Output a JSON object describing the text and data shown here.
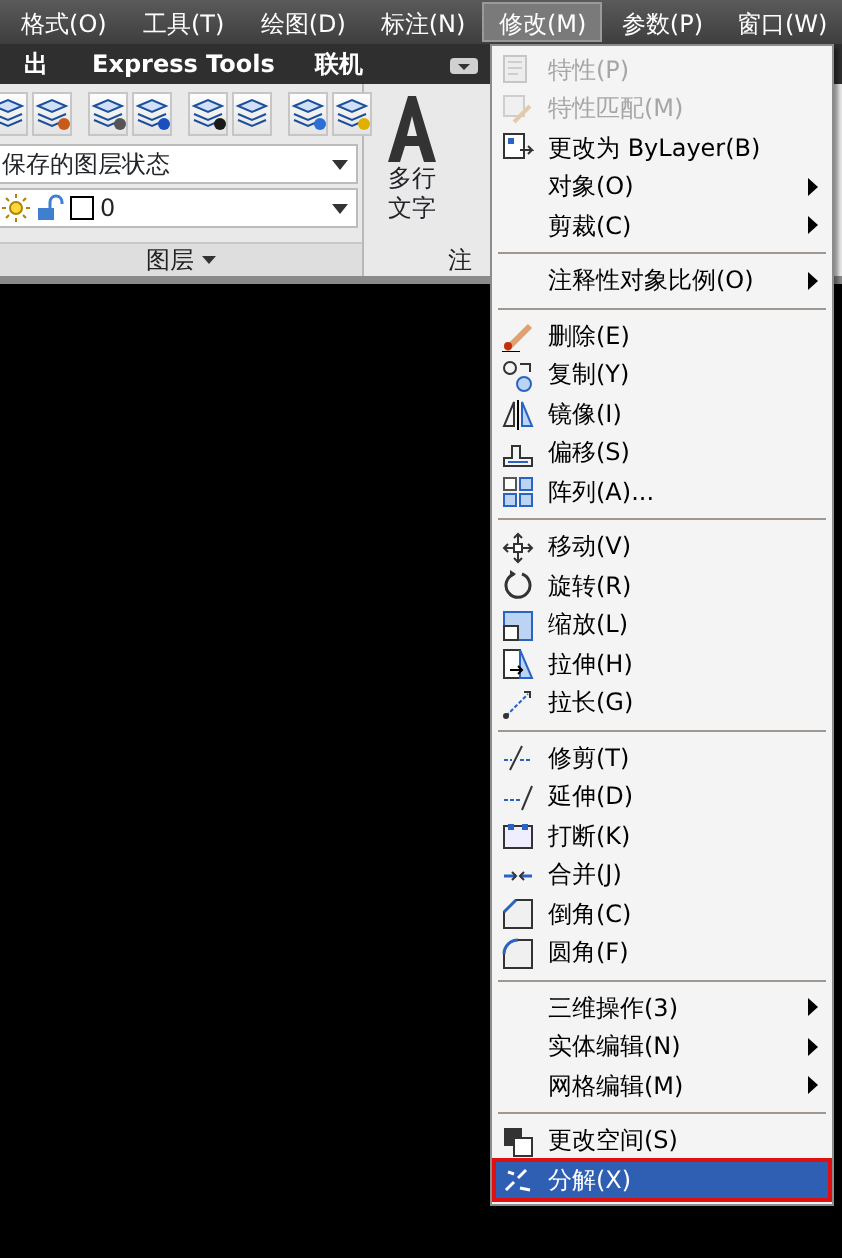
{
  "menu_bar": [
    {
      "label": "格式(O)",
      "selected": false
    },
    {
      "label": "工具(T)",
      "selected": false
    },
    {
      "label": "绘图(D)",
      "selected": false
    },
    {
      "label": "标注(N)",
      "selected": false
    },
    {
      "label": "修改(M)",
      "selected": true
    },
    {
      "label": "参数(P)",
      "selected": false
    },
    {
      "label": "窗口(W)",
      "selected": false
    }
  ],
  "ribbon_tabs": [
    {
      "label": "出"
    },
    {
      "label": "Express Tools"
    },
    {
      "label": "联机"
    }
  ],
  "ribbon": {
    "layer_state": {
      "value": "保存的图层状态"
    },
    "layer": {
      "value": "0"
    },
    "layers_panel_title": "图层",
    "text_tool": {
      "label_lines": [
        "多行",
        "文字"
      ]
    },
    "annotation_panel_title": "注"
  },
  "modify_menu": [
    {
      "kind": "item",
      "label": "特性(P)",
      "disabled": true,
      "submenu": false,
      "selected": false,
      "annotated": false
    },
    {
      "kind": "item",
      "label": "特性匹配(M)",
      "disabled": true,
      "submenu": false,
      "selected": false,
      "annotated": false
    },
    {
      "kind": "item",
      "label": "更改为 ByLayer(B)",
      "disabled": false,
      "submenu": false,
      "selected": false,
      "annotated": false
    },
    {
      "kind": "item",
      "label": "对象(O)",
      "disabled": false,
      "submenu": true,
      "selected": false,
      "annotated": false
    },
    {
      "kind": "item",
      "label": "剪裁(C)",
      "disabled": false,
      "submenu": true,
      "selected": false,
      "annotated": false
    },
    {
      "kind": "separator"
    },
    {
      "kind": "item",
      "label": "注释性对象比例(O)",
      "disabled": false,
      "submenu": true,
      "selected": false,
      "annotated": false
    },
    {
      "kind": "separator"
    },
    {
      "kind": "item",
      "label": "删除(E)",
      "disabled": false,
      "submenu": false,
      "selected": false,
      "annotated": false
    },
    {
      "kind": "item",
      "label": "复制(Y)",
      "disabled": false,
      "submenu": false,
      "selected": false,
      "annotated": false
    },
    {
      "kind": "item",
      "label": "镜像(I)",
      "disabled": false,
      "submenu": false,
      "selected": false,
      "annotated": false
    },
    {
      "kind": "item",
      "label": "偏移(S)",
      "disabled": false,
      "submenu": false,
      "selected": false,
      "annotated": false
    },
    {
      "kind": "item",
      "label": "阵列(A)...",
      "disabled": false,
      "submenu": false,
      "selected": false,
      "annotated": false
    },
    {
      "kind": "separator"
    },
    {
      "kind": "item",
      "label": "移动(V)",
      "disabled": false,
      "submenu": false,
      "selected": false,
      "annotated": false
    },
    {
      "kind": "item",
      "label": "旋转(R)",
      "disabled": false,
      "submenu": false,
      "selected": false,
      "annotated": false
    },
    {
      "kind": "item",
      "label": "缩放(L)",
      "disabled": false,
      "submenu": false,
      "selected": false,
      "annotated": false
    },
    {
      "kind": "item",
      "label": "拉伸(H)",
      "disabled": false,
      "submenu": false,
      "selected": false,
      "annotated": false
    },
    {
      "kind": "item",
      "label": "拉长(G)",
      "disabled": false,
      "submenu": false,
      "selected": false,
      "annotated": false
    },
    {
      "kind": "separator"
    },
    {
      "kind": "item",
      "label": "修剪(T)",
      "disabled": false,
      "submenu": false,
      "selected": false,
      "annotated": false
    },
    {
      "kind": "item",
      "label": "延伸(D)",
      "disabled": false,
      "submenu": false,
      "selected": false,
      "annotated": false
    },
    {
      "kind": "item",
      "label": "打断(K)",
      "disabled": false,
      "submenu": false,
      "selected": false,
      "annotated": false
    },
    {
      "kind": "item",
      "label": "合并(J)",
      "disabled": false,
      "submenu": false,
      "selected": false,
      "annotated": false
    },
    {
      "kind": "item",
      "label": "倒角(C)",
      "disabled": false,
      "submenu": false,
      "selected": false,
      "annotated": false
    },
    {
      "kind": "item",
      "label": "圆角(F)",
      "disabled": false,
      "submenu": false,
      "selected": false,
      "annotated": false
    },
    {
      "kind": "separator"
    },
    {
      "kind": "item",
      "label": "三维操作(3)",
      "disabled": false,
      "submenu": true,
      "selected": false,
      "annotated": false
    },
    {
      "kind": "item",
      "label": "实体编辑(N)",
      "disabled": false,
      "submenu": true,
      "selected": false,
      "annotated": false
    },
    {
      "kind": "item",
      "label": "网格编辑(M)",
      "disabled": false,
      "submenu": true,
      "selected": false,
      "annotated": false
    },
    {
      "kind": "separator"
    },
    {
      "kind": "item",
      "label": "更改空间(S)",
      "disabled": false,
      "submenu": false,
      "selected": false,
      "annotated": false
    },
    {
      "kind": "item",
      "label": "分解(X)",
      "disabled": false,
      "submenu": false,
      "selected": true,
      "annotated": true
    }
  ]
}
